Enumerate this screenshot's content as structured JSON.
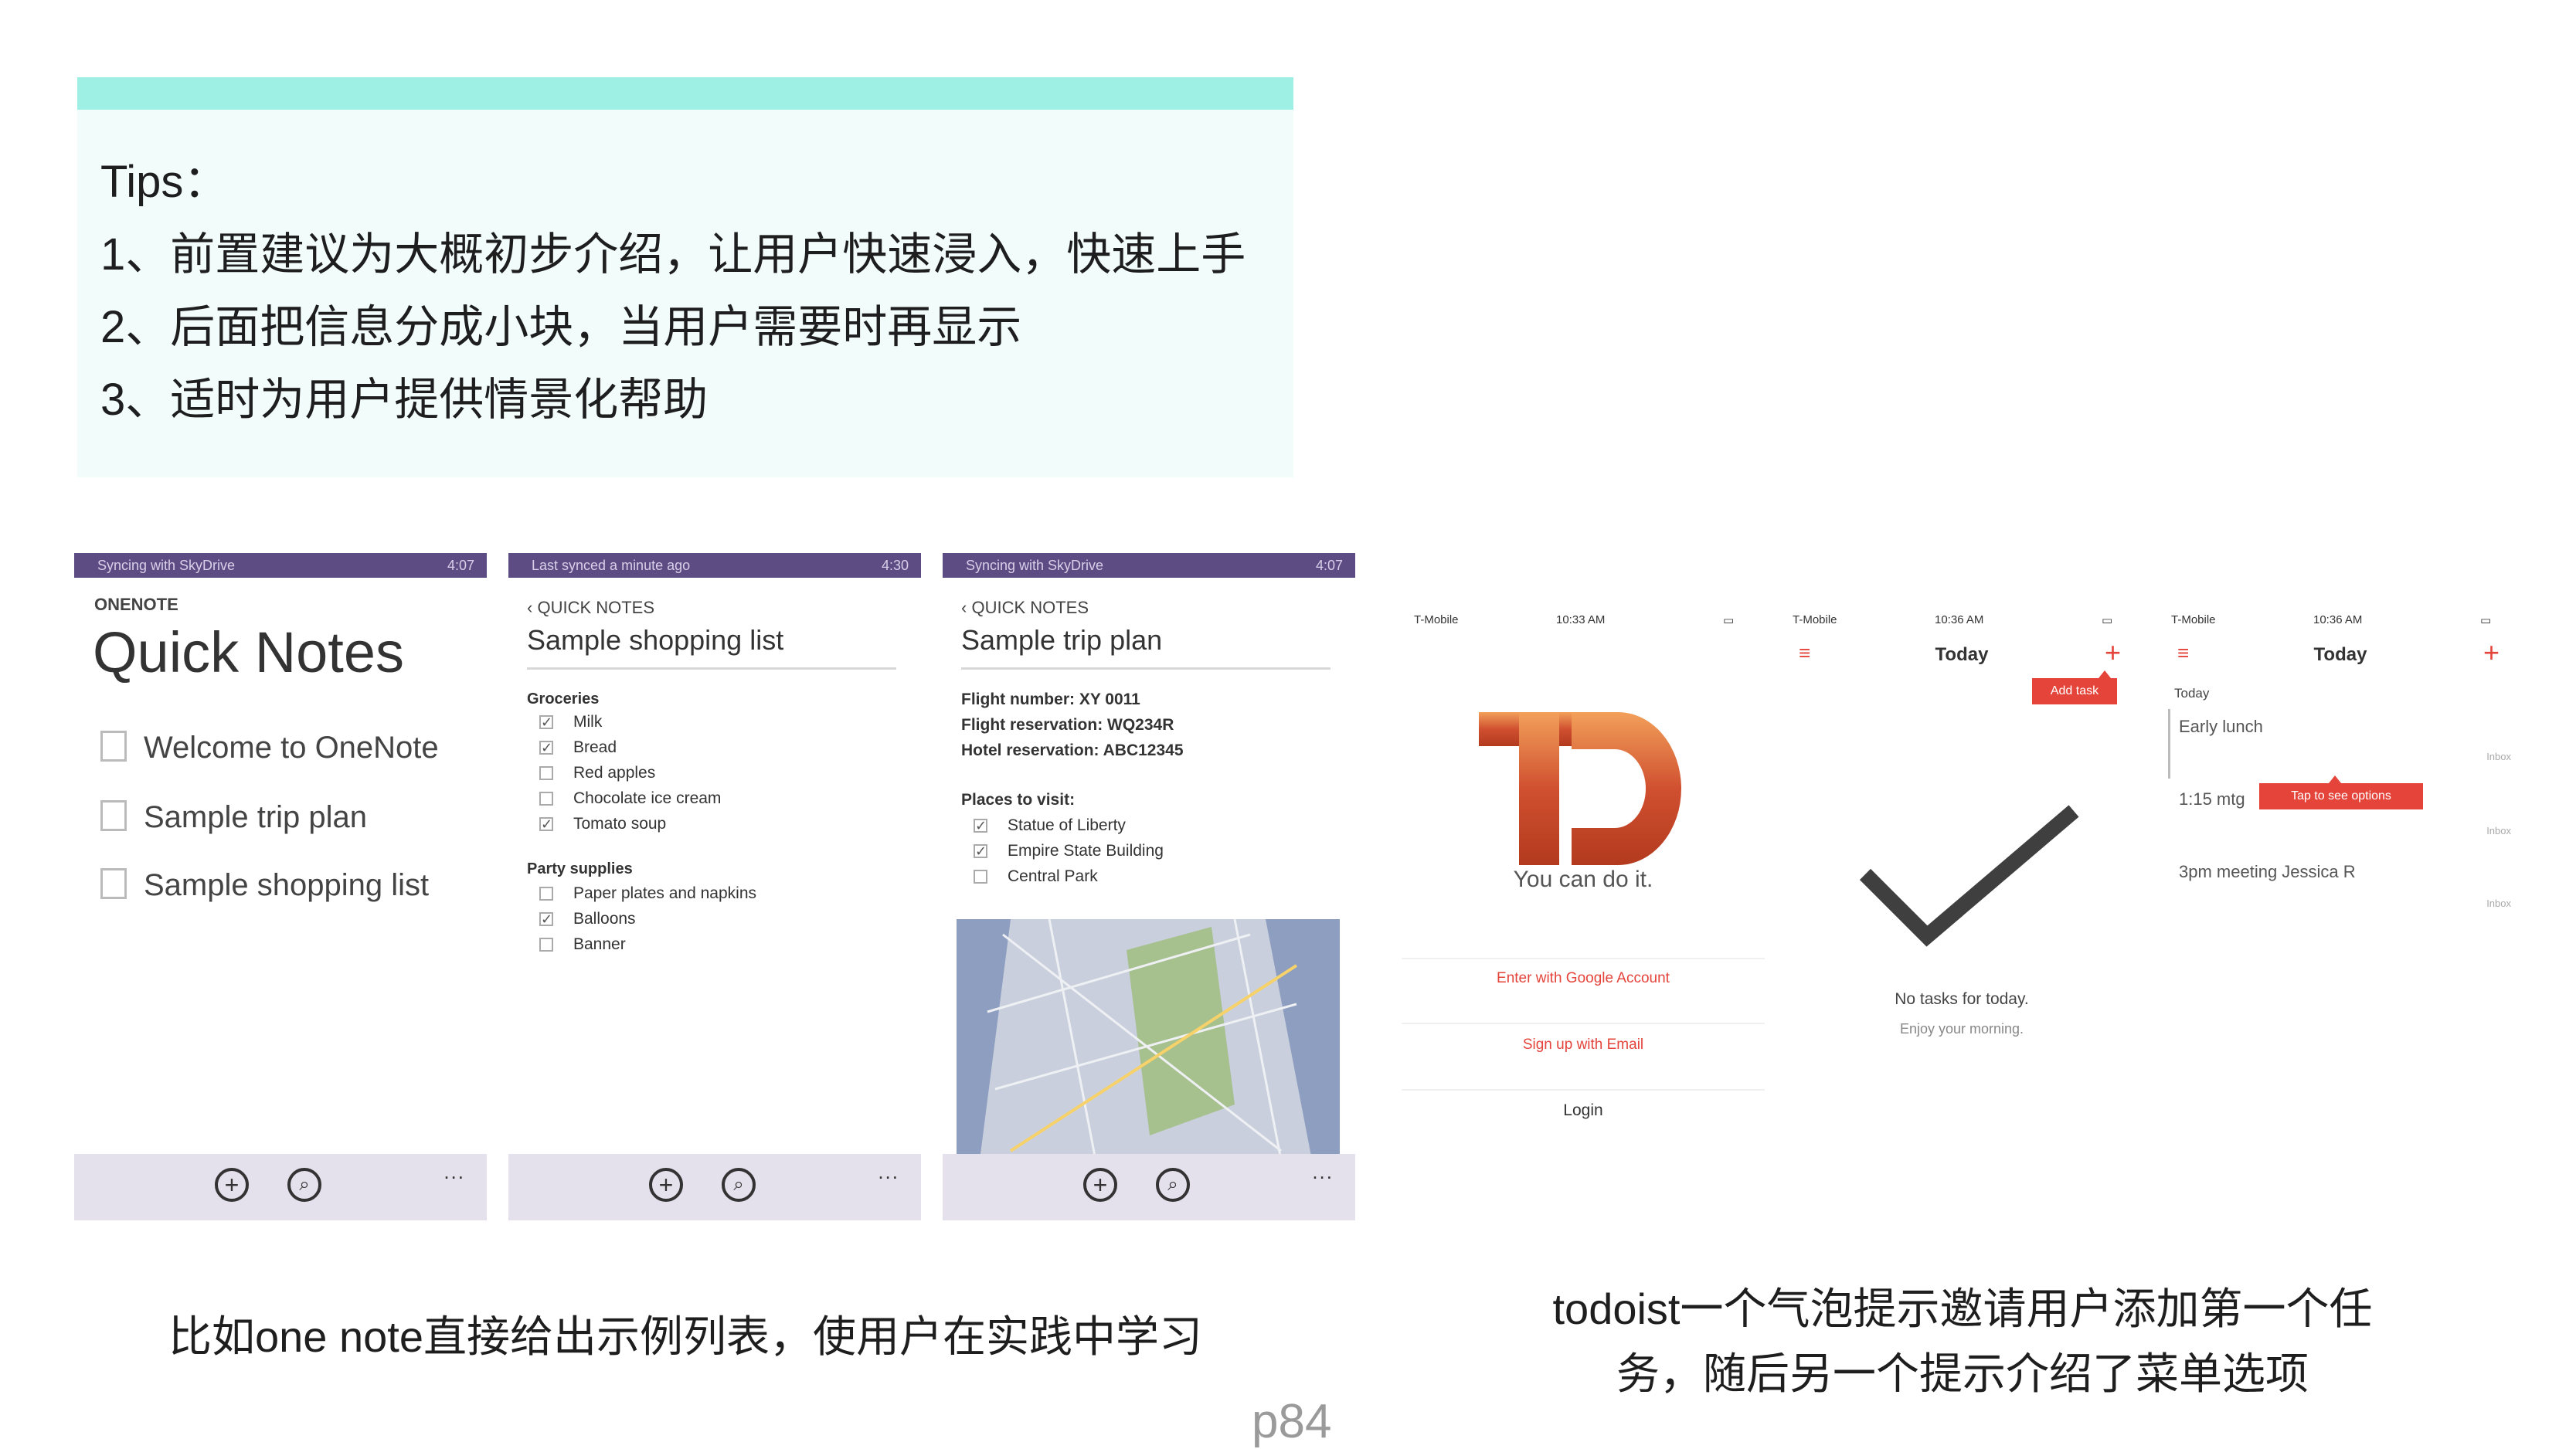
{
  "tips": {
    "title": "Tips：",
    "items": [
      "1、前置建议为大概初步介绍，让用户快速浸入，快速上手",
      "2、后面把信息分成小块，当用户需要时再显示",
      "3、适时为用户提供情景化帮助"
    ]
  },
  "onenote": {
    "screen1": {
      "status_left": "Syncing with SkyDrive",
      "status_right": "4:07",
      "app_label": "ONENOTE",
      "title": "Quick Notes",
      "notes": [
        "Welcome to OneNote",
        "Sample trip plan",
        "Sample shopping list"
      ]
    },
    "screen2": {
      "status_left": "Last synced a minute ago",
      "status_right": "4:30",
      "back_label": "QUICK NOTES",
      "title": "Sample shopping list",
      "groceries_header": "Groceries",
      "groceries": [
        "Milk",
        "Bread",
        "Red apples",
        "Chocolate ice cream",
        "Tomato soup"
      ],
      "party_header": "Party supplies",
      "party": [
        "Paper plates and napkins",
        "Balloons",
        "Banner"
      ]
    },
    "screen3": {
      "status_left": "Syncing with SkyDrive",
      "status_right": "4:07",
      "back_label": "QUICK NOTES",
      "title": "Sample trip plan",
      "details": [
        "Flight number: XY 0011",
        "Flight reservation: WQ234R",
        "Hotel reservation: ABC12345"
      ],
      "places_header": "Places to visit:",
      "places": [
        "Statue of Liberty",
        "Empire State Building",
        "Central Park"
      ]
    },
    "appbar_more": "..."
  },
  "todoist": {
    "screen1": {
      "carrier": "T-Mobile",
      "time": "10:33 AM",
      "tagline": "You can do it.",
      "google_button": "Enter with Google Account",
      "email_button": "Sign up with Email",
      "login_button": "Login"
    },
    "screen2": {
      "carrier": "T-Mobile",
      "time": "10:36 AM",
      "title": "Today",
      "tooltip": "Add task",
      "empty_title": "No tasks for today.",
      "empty_subtitle": "Enjoy your morning."
    },
    "screen3": {
      "carrier": "T-Mobile",
      "time": "10:36 AM",
      "title": "Today",
      "section": "Today",
      "tasks": [
        "Early lunch",
        "1:15 mtg",
        "3pm meeting Jessica R"
      ],
      "tooltip": "Tap to see options",
      "task_meta": "Inbox"
    },
    "accent": "#e4443a"
  },
  "captions": {
    "left": "比如one note直接给出示例列表，使用户在实践中学习",
    "right_line1": "todoist一个气泡提示邀请用户添加第一个任",
    "right_line2": "务，随后另一个提示介绍了菜单选项"
  },
  "page_number": "p84"
}
